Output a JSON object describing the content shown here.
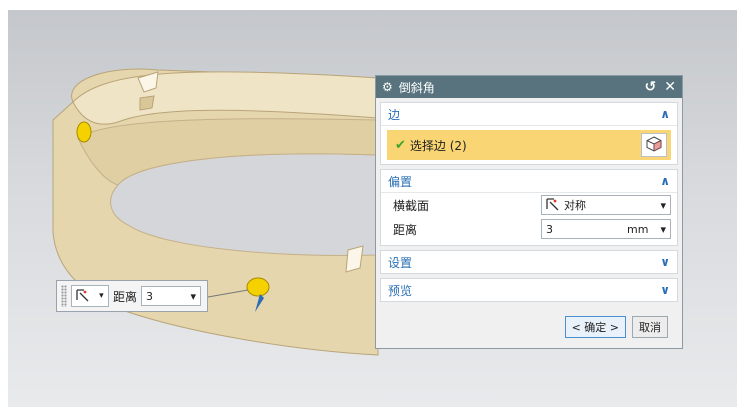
{
  "dialog": {
    "title": "倒斜角",
    "sections": {
      "edge": {
        "label": "边",
        "collapsed": false,
        "select_label": "选择边 (2)"
      },
      "offset": {
        "label": "偏置",
        "collapsed": false,
        "cross_section_label": "横截面",
        "cross_section_value": "对称",
        "distance_label": "距离",
        "distance_value": "3",
        "distance_unit": "mm"
      },
      "settings": {
        "label": "设置",
        "collapsed": true
      },
      "preview": {
        "label": "预览",
        "collapsed": true
      }
    },
    "ok_label": "< 确定 >",
    "cancel_label": "取消"
  },
  "mini_toolbar": {
    "distance_label": "距离",
    "distance_value": "3"
  },
  "colors": {
    "titlebar": "#58737e",
    "section_header": "#2a6fb6",
    "selection_highlight": "#f9d673",
    "ring": "#e2d0a8"
  }
}
